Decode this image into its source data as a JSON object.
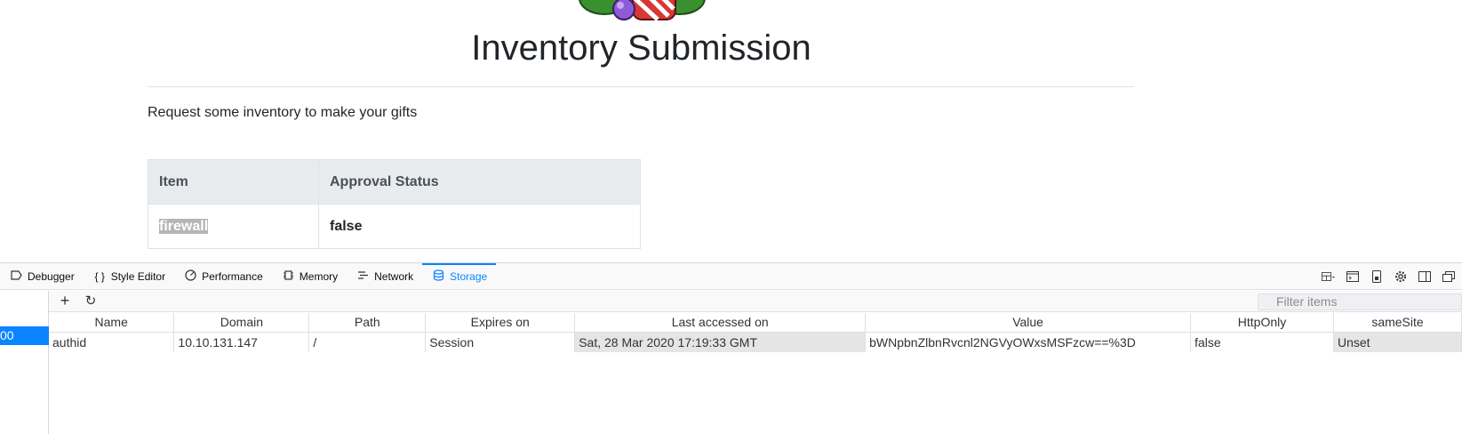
{
  "page": {
    "title": "Inventory Submission",
    "intro": "Request some inventory to make your gifts",
    "table": {
      "headers": [
        "Item",
        "Approval Status"
      ],
      "rows": [
        [
          "firewall",
          "false"
        ]
      ]
    }
  },
  "devtools": {
    "tabs": [
      {
        "label": "Debugger",
        "icon": "debugger-icon"
      },
      {
        "label": "Style Editor",
        "icon": "braces-icon"
      },
      {
        "label": "Performance",
        "icon": "performance-icon"
      },
      {
        "label": "Memory",
        "icon": "memory-icon"
      },
      {
        "label": "Network",
        "icon": "network-icon"
      },
      {
        "label": "Storage",
        "icon": "storage-icon"
      }
    ],
    "active_tab": "Storage",
    "sidebar_selected": "00",
    "filter_placeholder": "Filter items",
    "columns": [
      "Name",
      "Domain",
      "Path",
      "Expires on",
      "Last accessed on",
      "Value",
      "HttpOnly",
      "sameSite"
    ],
    "cookies": [
      {
        "name": "authid",
        "domain": "10.10.131.147",
        "path": "/",
        "expires": "Session",
        "last_accessed": "Sat, 28 Mar 2020 17:19:33 GMT",
        "value": "bWNpbnZlbnRvcnl2NGVyOWxsMSFzcw==%3D",
        "httponly": "false",
        "samesite": "Unset"
      }
    ],
    "accent_color": "#0a84ff"
  }
}
